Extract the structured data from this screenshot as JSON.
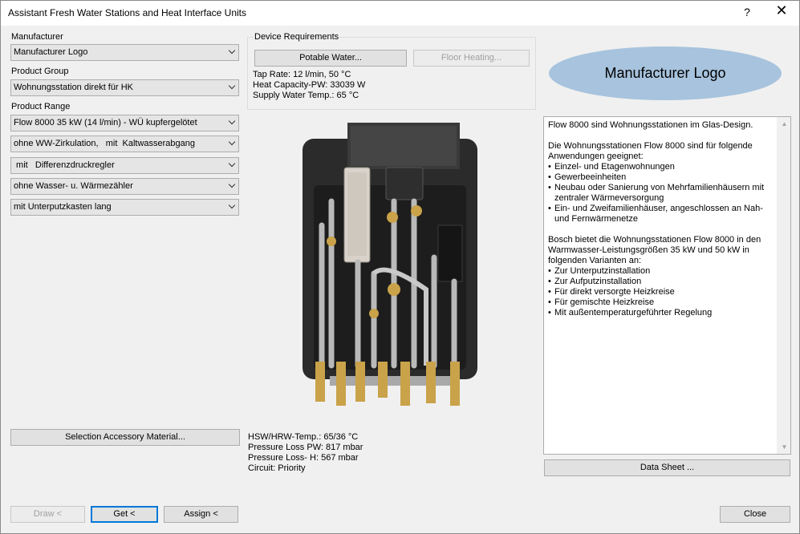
{
  "window": {
    "title": "Assistant Fresh Water Stations and Heat Interface Units",
    "help_label": "?",
    "close_glyph": "✕"
  },
  "left": {
    "manufacturer_label": "Manufacturer",
    "manufacturer_value": "Manufacturer Logo",
    "product_group_label": "Product Group",
    "product_group_value": "Wohnungsstation direkt für HK",
    "product_range_label": "Product Range",
    "product_range_value": "Flow 8000 35 kW (14 l/min) - WÜ kupfergelötet",
    "option_1": "ohne WW-Zirkulation,   mit  Kaltwasserabgang",
    "option_2": " mit   Differenzdruckregler",
    "option_3": "ohne Wasser- u. Wärmezähler",
    "option_4": "mit Unterputzkasten lang",
    "accessory_button": "Selection Accessory Material..."
  },
  "requirements": {
    "title": "Device Requirements",
    "potable_button": "Potable Water...",
    "floor_button": "Floor Heating...",
    "tap_rate": "Tap Rate: 12 l/min, 50 °C",
    "heat_capacity": "Heat Capacity-PW: 33039 W",
    "supply_temp": "Supply Water Temp.: 65 °C"
  },
  "results": {
    "hsw_temp": "HSW/HRW-Temp.: 65/36 °C",
    "pressure_pw": "Pressure Loss PW: 817 mbar",
    "pressure_h": "Pressure Loss- H: 567 mbar",
    "circuit": "Circuit: Priority"
  },
  "logo": {
    "text": "Manufacturer Logo",
    "color": "#a7c3dd"
  },
  "description": {
    "intro": "Flow 8000 sind Wohnungsstationen im Glas-Design.",
    "para1": "Die Wohnungsstationen Flow 8000 sind für folgende Anwendungen geeignet:",
    "list1": [
      "Einzel- und Etagenwohnungen",
      "Gewerbeeinheiten",
      "Neubau oder Sanierung von Mehrfamilienhäusern mit zentraler Wärmeversorgung",
      "Ein- und Zweifamilienhäuser, angeschlossen an Nah- und Fernwärmenetze"
    ],
    "para2": "Bosch bietet die Wohnungsstationen Flow 8000 in den Warmwasser-Leistungsgrößen 35 kW und 50 kW in folgenden Varianten an:",
    "list2": [
      "Zur Unterputzinstallation",
      "Zur Aufputzinstallation",
      "Für direkt versorgte Heizkreise",
      "Für gemischte Heizkreise",
      "Mit außentemperaturgeführter Regelung"
    ]
  },
  "footer": {
    "draw": "Draw <",
    "get": "Get <",
    "assign": "Assign <",
    "datasheet": "Data Sheet ...",
    "close": "Close"
  },
  "colors": {
    "accent": "#0078d7",
    "window_bg": "#f0f0f0",
    "pipe_brass": "#c9a24a",
    "pipe_steel": "#b9b9b9"
  }
}
